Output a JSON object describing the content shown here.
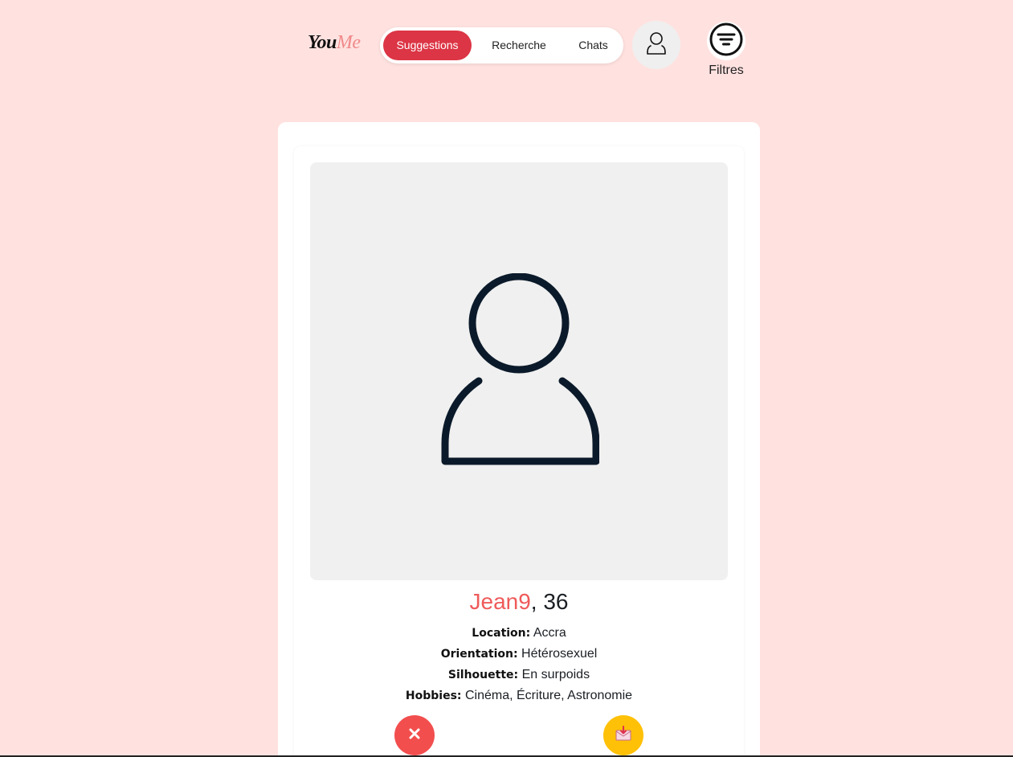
{
  "brand": {
    "part1": "You",
    "part2": "Me"
  },
  "nav": {
    "tabs": [
      {
        "label": "Suggestions",
        "active": true
      },
      {
        "label": "Recherche",
        "active": false
      },
      {
        "label": "Chats",
        "active": false
      }
    ]
  },
  "header": {
    "profile_icon": "user-outline-icon",
    "filter_icon": "filter-lines-icon",
    "filter_label": "Filtres"
  },
  "profile": {
    "username": "Jean9",
    "age_text": ", 36",
    "photo_icon": "user-placeholder-icon",
    "details": [
      {
        "key": "Location:",
        "value": "Accra"
      },
      {
        "key": "Orientation:",
        "value": "Hétérosexuel"
      },
      {
        "key": "Silhouette:",
        "value": "En surpoids"
      },
      {
        "key": "Hobbies:",
        "value": "Cinéma, Écriture, Astronomie"
      }
    ]
  },
  "actions": {
    "reject_icon": "close-icon",
    "message_icon": "envelope-icon"
  },
  "colors": {
    "background": "#ffe2e0",
    "accent": "#dc3545",
    "username": "#ef5a5a",
    "reject": "#f24e4e",
    "message": "#ffc107"
  }
}
